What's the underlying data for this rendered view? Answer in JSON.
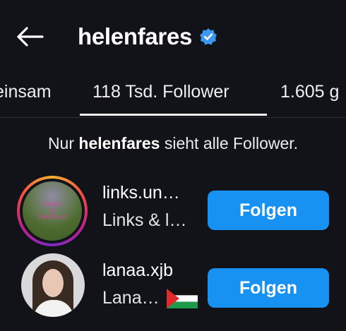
{
  "header": {
    "title": "helenfares",
    "verified": true,
    "back_icon": "arrow-left-icon"
  },
  "tabs": [
    {
      "label": "einsam",
      "active": false
    },
    {
      "label": "118 Tsd. Follower",
      "active": true
    },
    {
      "label": "1.605 g",
      "active": false
    }
  ],
  "notice": {
    "prefix": "Nur ",
    "name": "helenfares",
    "suffix": " sieht alle Follower."
  },
  "followers": [
    {
      "username": "links.un…",
      "full_name": "Links & l…",
      "button_label": "Folgen",
      "story_ring": true,
      "avatar_text_top": "links",
      "avatar_text_bottom": "&",
      "avatar_text_extra": "landlust"
    },
    {
      "username": "lanaa.xjb",
      "full_name": "Lana 🤍",
      "button_label": "Folgen",
      "story_ring": false,
      "flag_icon": "palestine-flag-icon"
    }
  ],
  "colors": {
    "background": "#111318",
    "accent": "#1791f2",
    "verified": "#3b97f0"
  }
}
